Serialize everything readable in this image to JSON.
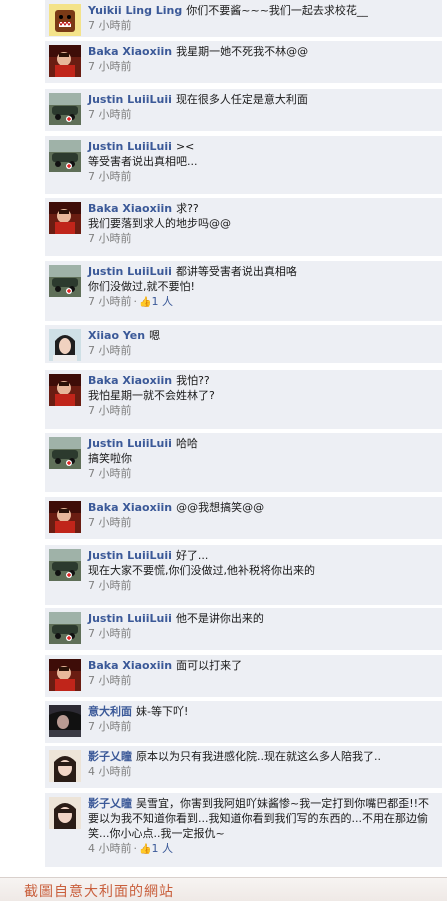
{
  "comments": [
    {
      "name": "Yuikii Ling Ling",
      "text": "你们不要酱~~~我们一起去求校花__",
      "time": "7 小時前",
      "avatar": "domo"
    },
    {
      "name": "Baka Xiaoxiin",
      "text": "我星期一她不死我不林@@",
      "time": "7 小時前",
      "avatar": "red"
    },
    {
      "name": "Justin LuiiLuii",
      "text": "现在很多人任定是意大利面",
      "time": "7 小時前",
      "avatar": "car"
    },
    {
      "name": "Justin LuiiLuii",
      "text": "><",
      "text2": "等受害者说出真相吧...",
      "time": "7 小時前",
      "avatar": "car"
    },
    {
      "name": "Baka Xiaoxiin",
      "text": "求??",
      "text2": "我们要落到求人的地步吗@@",
      "time": "7 小時前",
      "avatar": "red"
    },
    {
      "name": "Justin LuiiLuii",
      "text": "都讲等受害者说出真相咯",
      "text2": "你们没做过,就不要怕!",
      "time": "7 小時前",
      "likes": "1 人",
      "avatar": "car"
    },
    {
      "name": "Xiiao Yen",
      "text": "嗯",
      "time": "7 小時前",
      "avatar": "girl"
    },
    {
      "name": "Baka Xiaoxiin",
      "text": "我怕??",
      "text2": "我怕星期一就不会姓林了?",
      "time": "7 小時前",
      "avatar": "red"
    },
    {
      "name": "Justin LuiiLuii",
      "text": "哈哈",
      "text2": "搞笑啦你",
      "time": "7 小時前",
      "avatar": "car"
    },
    {
      "name": "Baka Xiaoxiin",
      "text": "@@我想搞笑@@",
      "time": "7 小時前",
      "avatar": "red"
    },
    {
      "name": "Justin LuiiLuii",
      "text": "好了...",
      "text2": "现在大家不要慌,你们没做过,他补税将你出来的",
      "time": "7 小時前",
      "avatar": "car"
    },
    {
      "name": "Justin LuiiLuii",
      "text": "他不是讲你出来的",
      "time": "7 小時前",
      "avatar": "car"
    },
    {
      "name": "Baka Xiaoxiin",
      "text": "面可以打来了",
      "time": "7 小時前",
      "avatar": "red"
    },
    {
      "name": "意大利面",
      "text": "妹-等下吖!",
      "time": "7 小時前",
      "avatar": "dark"
    },
    {
      "name": "影子乂瞳",
      "text": "原本以为只有我进感化院..现在就这么多人陪我了..",
      "time": "4 小時前",
      "avatar": "shadow"
    },
    {
      "name": "影子乂瞳",
      "text": "吴雪宜，你害到我阿姐吖妹酱惨~我一定打到你嘴巴都歪!!不要以为我不知道你看到...我知道你看到我们写的东西的...不用在那边偷笑...你小心点..我一定报仇~",
      "time": "4 小時前",
      "likes": "1 人",
      "avatar": "shadow"
    }
  ],
  "watermark": "截圖自意大利面的網站"
}
